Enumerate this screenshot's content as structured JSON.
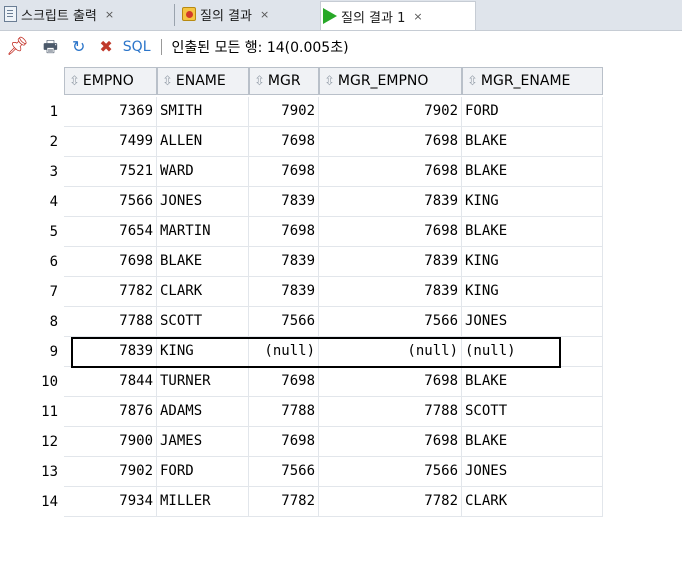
{
  "tabs": [
    {
      "label": "스크립트 출력",
      "close": "×",
      "icon": "script-doc-icon"
    },
    {
      "label": "질의 결과",
      "close": "×",
      "icon": "query-result-icon"
    },
    {
      "label": "질의 결과 1",
      "close": "×",
      "icon": "run-play-icon",
      "active": true
    }
  ],
  "toolbar": {
    "icons": [
      "pin-icon",
      "print-icon",
      "refresh-icon",
      "cancel-sql-icon"
    ],
    "sql_label": "SQL",
    "separator": "|",
    "status": "인출된 모든 행: 14(0.005초)"
  },
  "grid": {
    "columns": [
      "EMPNO",
      "ENAME",
      "MGR",
      "MGR_EMPNO",
      "MGR_ENAME"
    ],
    "rows": [
      {
        "num": "1",
        "empno": "7369",
        "ename": "SMITH",
        "mgr": "7902",
        "mgr_empno": "7902",
        "mgr_ename": "FORD"
      },
      {
        "num": "2",
        "empno": "7499",
        "ename": "ALLEN",
        "mgr": "7698",
        "mgr_empno": "7698",
        "mgr_ename": "BLAKE"
      },
      {
        "num": "3",
        "empno": "7521",
        "ename": "WARD",
        "mgr": "7698",
        "mgr_empno": "7698",
        "mgr_ename": "BLAKE"
      },
      {
        "num": "4",
        "empno": "7566",
        "ename": "JONES",
        "mgr": "7839",
        "mgr_empno": "7839",
        "mgr_ename": "KING"
      },
      {
        "num": "5",
        "empno": "7654",
        "ename": "MARTIN",
        "mgr": "7698",
        "mgr_empno": "7698",
        "mgr_ename": "BLAKE"
      },
      {
        "num": "6",
        "empno": "7698",
        "ename": "BLAKE",
        "mgr": "7839",
        "mgr_empno": "7839",
        "mgr_ename": "KING"
      },
      {
        "num": "7",
        "empno": "7782",
        "ename": "CLARK",
        "mgr": "7839",
        "mgr_empno": "7839",
        "mgr_ename": "KING"
      },
      {
        "num": "8",
        "empno": "7788",
        "ename": "SCOTT",
        "mgr": "7566",
        "mgr_empno": "7566",
        "mgr_ename": "JONES"
      },
      {
        "num": "9",
        "empno": "7839",
        "ename": "KING",
        "mgr": "(null)",
        "mgr_empno": "(null)",
        "mgr_ename": "(null)"
      },
      {
        "num": "10",
        "empno": "7844",
        "ename": "TURNER",
        "mgr": "7698",
        "mgr_empno": "7698",
        "mgr_ename": "BLAKE"
      },
      {
        "num": "11",
        "empno": "7876",
        "ename": "ADAMS",
        "mgr": "7788",
        "mgr_empno": "7788",
        "mgr_ename": "SCOTT"
      },
      {
        "num": "12",
        "empno": "7900",
        "ename": "JAMES",
        "mgr": "7698",
        "mgr_empno": "7698",
        "mgr_ename": "BLAKE"
      },
      {
        "num": "13",
        "empno": "7902",
        "ename": "FORD",
        "mgr": "7566",
        "mgr_empno": "7566",
        "mgr_ename": "JONES"
      },
      {
        "num": "14",
        "empno": "7934",
        "ename": "MILLER",
        "mgr": "7782",
        "mgr_empno": "7782",
        "mgr_ename": "CLARK"
      }
    ]
  },
  "colors": {
    "tabbar_bg": "#dfe4eb",
    "header_bg": "#f0f2f5",
    "sql_accent": "#2a74c9",
    "highlight_border": "#000000"
  }
}
